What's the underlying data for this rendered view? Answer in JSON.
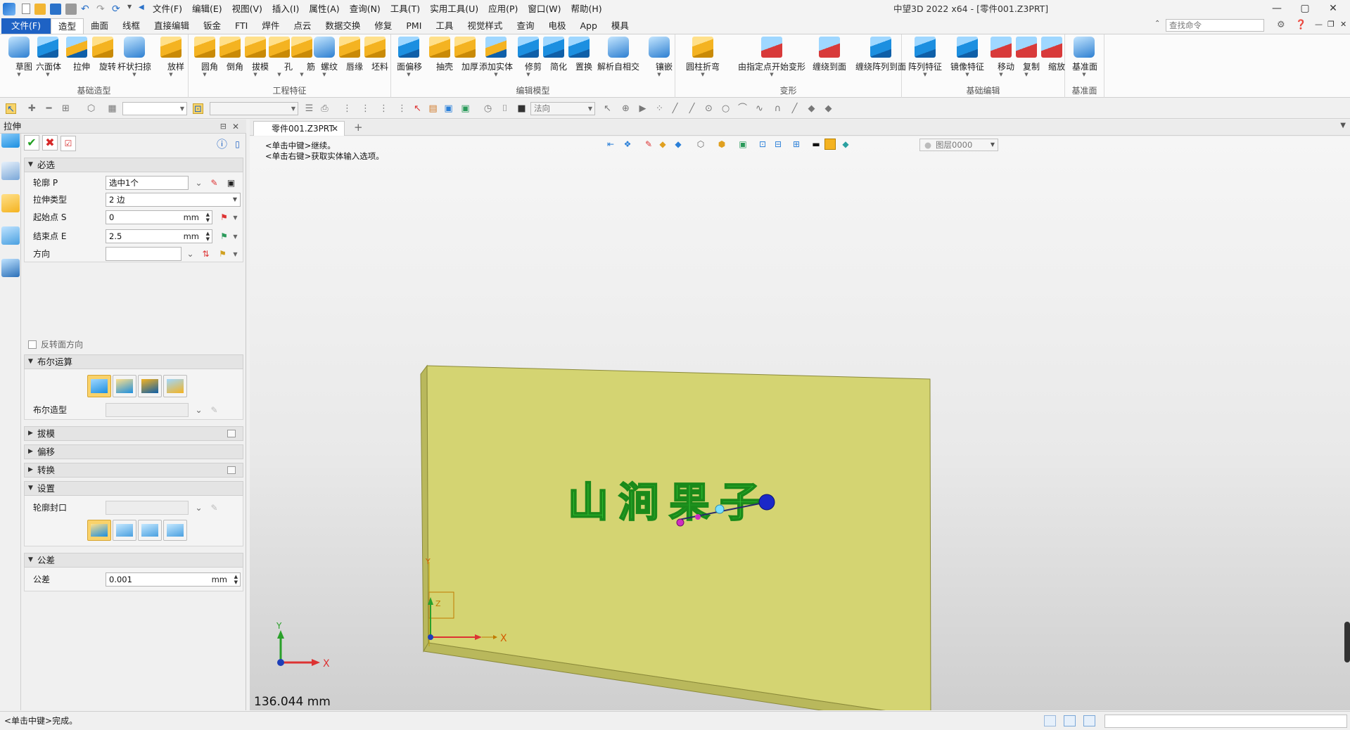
{
  "app": {
    "title": "中望3D 2022 x64 - [零件001.Z3PRT]",
    "menu": [
      "文件(F)",
      "编辑(E)",
      "视图(V)",
      "插入(I)",
      "属性(A)",
      "查询(N)",
      "工具(T)",
      "实用工具(U)",
      "应用(P)",
      "窗口(W)",
      "帮助(H)"
    ],
    "window_buttons": [
      "—",
      "▢",
      "✕"
    ]
  },
  "ribbon": {
    "file_tab": "文件(F)",
    "tabs": [
      "造型",
      "曲面",
      "线框",
      "直接编辑",
      "钣金",
      "FTI",
      "焊件",
      "点云",
      "数据交换",
      "修复",
      "PMI",
      "工具",
      "视觉样式",
      "查询",
      "电极",
      "App",
      "模具"
    ],
    "active_tab": "造型",
    "search_placeholder": "查找命令",
    "groups": [
      {
        "label": "基础造型",
        "buttons": [
          "草图",
          "六面体",
          "拉伸",
          "旋转",
          "杆状扫掠",
          "放样"
        ]
      },
      {
        "label": "工程特征",
        "buttons": [
          "圆角",
          "倒角",
          "拔模",
          "孔",
          "筋",
          "螺纹",
          "唇缘",
          "坯料"
        ]
      },
      {
        "label": "编辑模型",
        "buttons": [
          "面偏移",
          "抽壳",
          "加厚",
          "添加实体",
          "修剪",
          "简化",
          "置换",
          "解析自相交",
          "镶嵌"
        ]
      },
      {
        "label": "变形",
        "buttons": [
          "圆柱折弯",
          "由指定点开始变形",
          "缠绕到面",
          "缠绕阵列到面"
        ]
      },
      {
        "label": "基础编辑",
        "buttons": [
          "阵列特征",
          "镜像特征",
          "移动",
          "复制",
          "缩放"
        ]
      },
      {
        "label": "基准面",
        "buttons": [
          "基准面"
        ]
      }
    ]
  },
  "toolbar2": {
    "filter_value": "",
    "normal_label": "法向"
  },
  "panel": {
    "title": "拉伸",
    "sections": {
      "required": "必选",
      "boolean": "布尔运算",
      "draft": "拔模",
      "offset": "偏移",
      "transform": "转换",
      "settings": "设置",
      "tolerance": "公差"
    },
    "fields": {
      "profile_label": "轮廓 P",
      "profile_value": "选中1个",
      "type_label": "拉伸类型",
      "type_value": "2 边",
      "start_label": "起始点 S",
      "start_value": "0",
      "start_unit": "mm",
      "end_label": "结束点 E",
      "end_value": "2.5",
      "end_unit": "mm",
      "direction_label": "方向",
      "direction_value": "",
      "reverse_label": "反转面方向",
      "bool_shape_label": "布尔造型",
      "profile_cap_label": "轮廓封口",
      "tolerance_label": "公差",
      "tolerance_value": "0.001",
      "tolerance_unit": "mm"
    }
  },
  "document": {
    "tab": "零件001.Z3PRT",
    "prompt_lines": [
      "<单击中键>继续。",
      "<单击右键>获取实体输入选项。"
    ],
    "layer": "图层0000",
    "measure": "136.044 mm",
    "model_text": "山涧果子",
    "axis_x": "X",
    "axis_y": "Y",
    "axis_z": "Z"
  },
  "colors": {
    "accent": "#1e62c4",
    "plate_top": "#d4d472",
    "plate_side": "#b9b85c",
    "text_green": "#3ad23a",
    "bool_active": "#f9d26a"
  },
  "status": {
    "text": "<单击中键>完成。"
  }
}
